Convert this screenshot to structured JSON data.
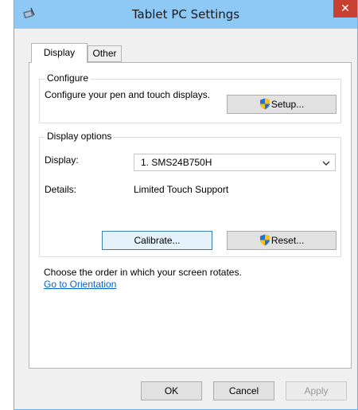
{
  "window": {
    "title": "Tablet PC Settings",
    "close_glyph": "✕"
  },
  "tabs": [
    {
      "label": "Display",
      "active": true
    },
    {
      "label": "Other",
      "active": false
    }
  ],
  "configure": {
    "group_label": "Configure",
    "description": "Configure your pen and touch displays.",
    "setup_label": "Setup..."
  },
  "display_options": {
    "group_label": "Display options",
    "display_label": "Display:",
    "display_value": "1. SMS24B750H",
    "details_label": "Details:",
    "details_value": "Limited Touch Support",
    "calibrate_label": "Calibrate...",
    "reset_label": "Reset..."
  },
  "orientation": {
    "text": "Choose the order in which your screen rotates.",
    "link": "Go to Orientation"
  },
  "footer": {
    "ok": "OK",
    "cancel": "Cancel",
    "apply": "Apply"
  },
  "colors": {
    "titlebar": "#8ec8f5",
    "close": "#c84031",
    "link": "#0066cc",
    "uac_blue": "#2a6fcf",
    "uac_yellow": "#f4c31b"
  }
}
